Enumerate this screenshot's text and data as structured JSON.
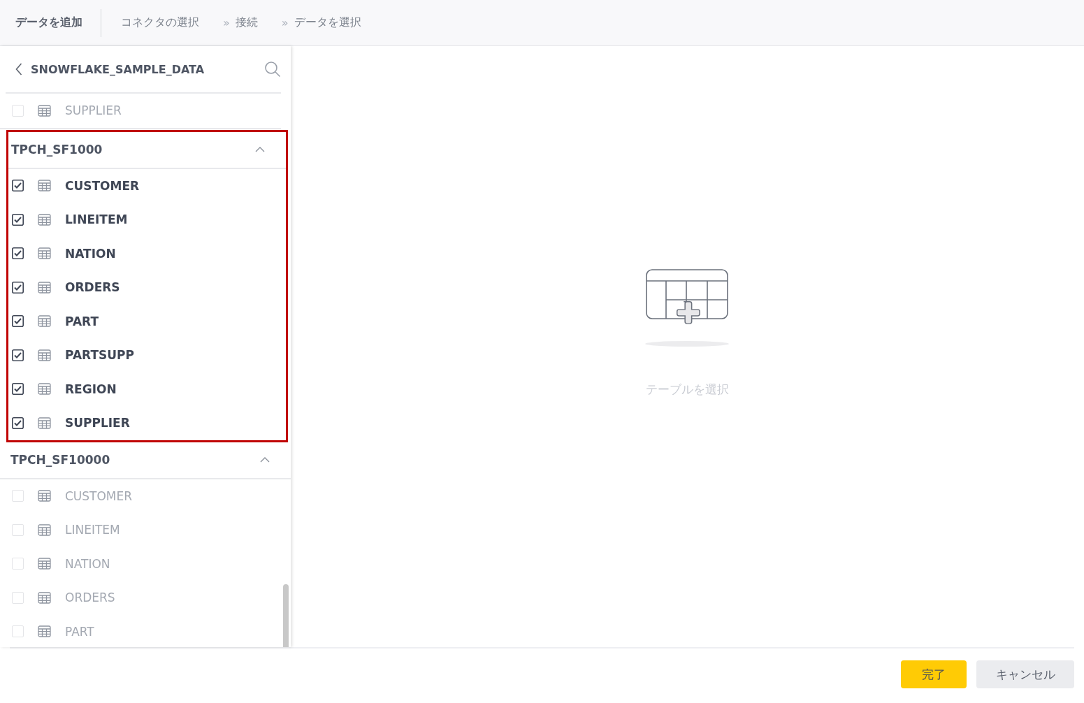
{
  "header": {
    "title": "データを追加",
    "steps": [
      {
        "label": "コネクタの選択"
      },
      {
        "label": "接続"
      },
      {
        "label": "データを選択"
      }
    ],
    "separator": "»"
  },
  "panel": {
    "title": "SNOWFLAKE_SAMPLE_DATA",
    "loose_items": [
      {
        "name": "SUPPLIER",
        "checked": false
      }
    ],
    "groups": [
      {
        "name": "TPCH_SF1000",
        "expanded": true,
        "highlighted": true,
        "items": [
          {
            "name": "CUSTOMER",
            "checked": true
          },
          {
            "name": "LINEITEM",
            "checked": true
          },
          {
            "name": "NATION",
            "checked": true
          },
          {
            "name": "ORDERS",
            "checked": true
          },
          {
            "name": "PART",
            "checked": true
          },
          {
            "name": "PARTSUPP",
            "checked": true
          },
          {
            "name": "REGION",
            "checked": true
          },
          {
            "name": "SUPPLIER",
            "checked": true
          }
        ]
      },
      {
        "name": "TPCH_SF10000",
        "expanded": true,
        "highlighted": false,
        "items": [
          {
            "name": "CUSTOMER",
            "checked": false
          },
          {
            "name": "LINEITEM",
            "checked": false
          },
          {
            "name": "NATION",
            "checked": false
          },
          {
            "name": "ORDERS",
            "checked": false
          },
          {
            "name": "PART",
            "checked": false
          }
        ]
      }
    ]
  },
  "empty_state": {
    "message": "テーブルを選択"
  },
  "buttons": [
    {
      "label": "完了",
      "kind": "primary"
    },
    {
      "label": "キャンセル",
      "kind": "secondary"
    }
  ]
}
